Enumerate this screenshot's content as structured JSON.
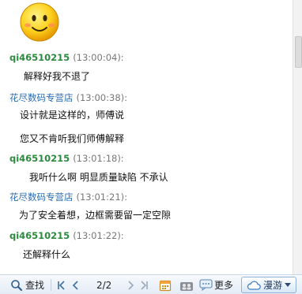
{
  "messages": [
    {
      "sender": "qi46510215",
      "time": "(13:00:04):",
      "lines": [
        "解释好我不退了"
      ]
    },
    {
      "sender": "花尽数码专营店",
      "time": "(13:00:38):",
      "lines": [
        "设计就是这样的，师傅说",
        "您又不肯听我们师傅解释"
      ]
    },
    {
      "sender": "qi46510215",
      "time": "(13:01:18):",
      "lines": [
        "我听什么啊 明显质量缺陷 不承认"
      ]
    },
    {
      "sender": "花尽数码专营店",
      "time": "(13:01:21):",
      "lines": [
        "为了安全着想，边框需要留一定空隙"
      ]
    },
    {
      "sender": "qi46510215",
      "time": "(13:01:22):",
      "lines": [
        "还解释什么"
      ]
    }
  ],
  "toolbar": {
    "search_label": "查找",
    "page_indicator": "2/2",
    "more_label": "更多",
    "roam_label": "漫游"
  },
  "icons": {
    "emoji": "smiley-face-icon",
    "search": "magnifier-icon",
    "first": "first-page-icon",
    "prev": "prev-page-icon",
    "next": "next-page-icon",
    "last": "last-page-icon",
    "calendar": "calendar-icon",
    "group": "group-icon",
    "chat": "chat-bubble-icon",
    "cloud": "cloud-icon",
    "dropdown": "dropdown-arrow-icon"
  },
  "colors": {
    "customer_name": "#2b8a3e",
    "shop_name": "#2b6cb0",
    "timestamp": "#777777",
    "toolbar_bg": "#e3ebf5"
  }
}
